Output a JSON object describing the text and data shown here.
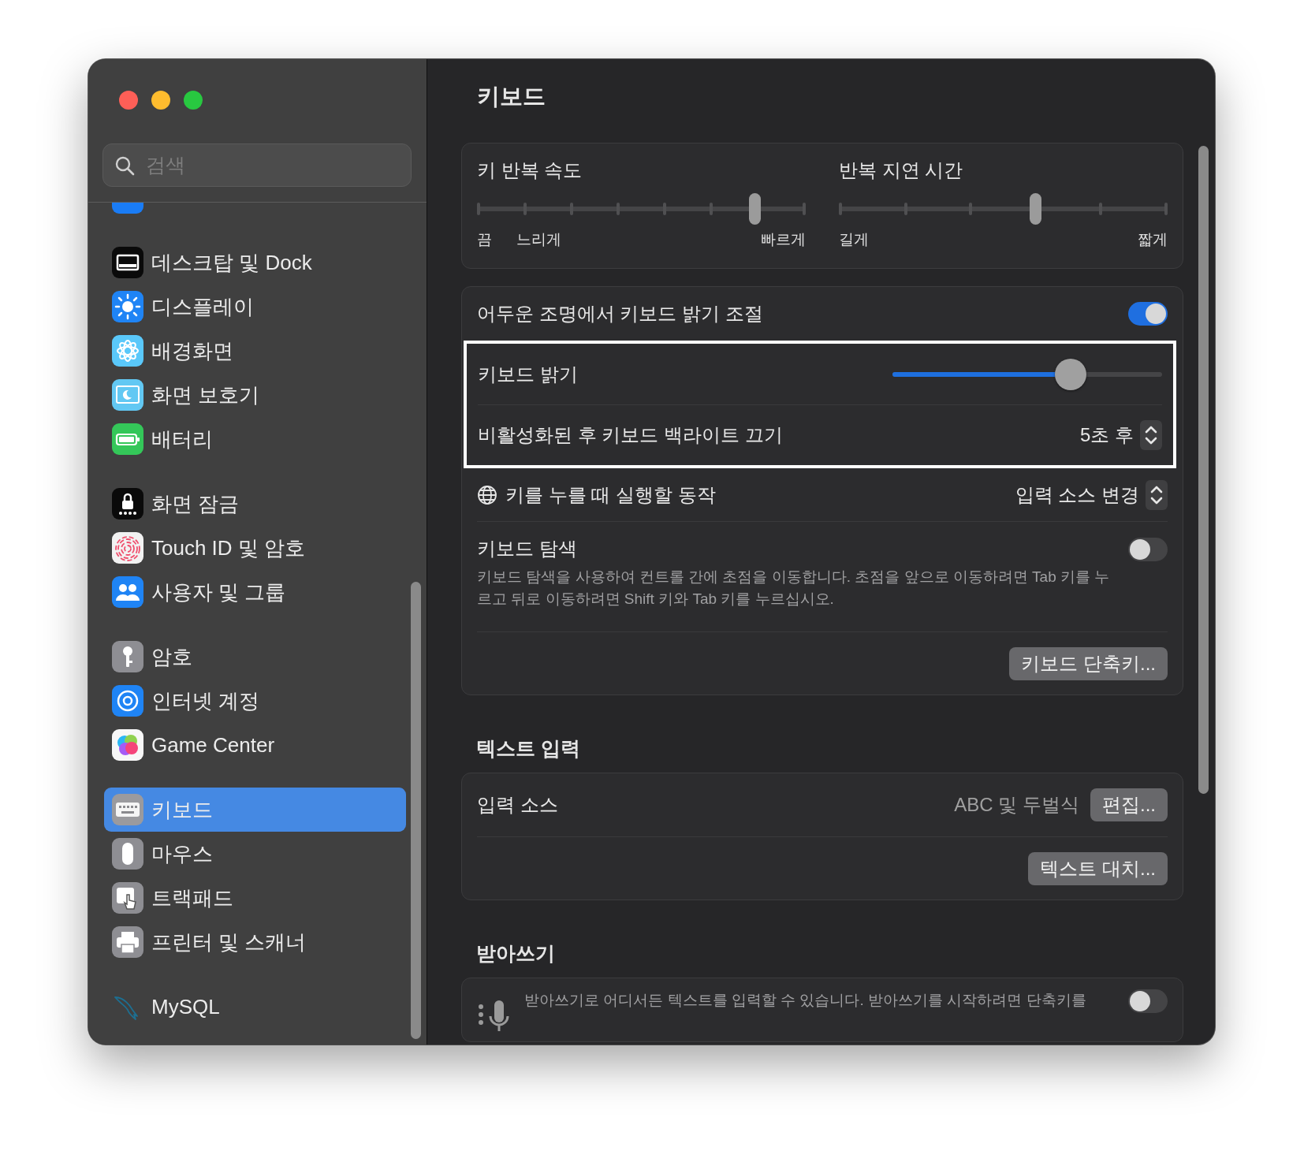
{
  "sidebar": {
    "search": {
      "placeholder": "검색"
    },
    "groups": [
      [
        {
          "kind": "privacy"
        }
      ],
      [
        {
          "label": "데스크탑 및 Dock",
          "kind": "desktop",
          "selected": false
        },
        {
          "label": "디스플레이",
          "kind": "display",
          "selected": false
        },
        {
          "label": "배경화면",
          "kind": "wallpaper",
          "selected": false
        },
        {
          "label": "화면 보호기",
          "kind": "screensaver",
          "selected": false
        },
        {
          "label": "배터리",
          "kind": "battery",
          "selected": false
        }
      ],
      [
        {
          "label": "화면 잠금",
          "kind": "lock",
          "selected": false
        },
        {
          "label": "Touch ID 및 암호",
          "kind": "touchid",
          "selected": false
        },
        {
          "label": "사용자 및 그룹",
          "kind": "users",
          "selected": false
        }
      ],
      [
        {
          "label": "암호",
          "kind": "password",
          "selected": false
        },
        {
          "label": "인터넷 계정",
          "kind": "internet",
          "selected": false
        },
        {
          "label": "Game Center",
          "kind": "gamecenter",
          "selected": false
        }
      ],
      [
        {
          "label": "키보드",
          "kind": "keyboard",
          "selected": true
        },
        {
          "label": "마우스",
          "kind": "mouse",
          "selected": false
        },
        {
          "label": "트랙패드",
          "kind": "trackpad",
          "selected": false
        },
        {
          "label": "프린터 및 스캐너",
          "kind": "printer",
          "selected": false
        }
      ],
      [
        {
          "label": "MySQL",
          "kind": "mysql",
          "selected": false
        }
      ]
    ]
  },
  "content": {
    "title": "키보드",
    "repeat": [
      {
        "label": "키 반복 속도",
        "level": 0.857,
        "labels": [
          "끔",
          "느리게",
          "빠르게"
        ]
      },
      {
        "label": "반복 지연 시간",
        "level": 0.6,
        "labels": [
          "길게",
          "짧게"
        ]
      }
    ],
    "sections": [
      {
        "rows": [
          {
            "kind": "toggle",
            "label": "어두운 조명에서 키보드 밝기 조절",
            "on": true
          },
          {
            "kind": "slider",
            "label": "키보드 밝기",
            "level": 0.66,
            "highlighted": true
          },
          {
            "kind": "popup",
            "label": "비활성화된 후 키보드 백라이트 끄기",
            "value": "5초 후",
            "highlighted": true
          },
          {
            "kind": "popup",
            "label": "키를 누를 때 실행할 동작",
            "value": "입력 소스 변경",
            "globe": true
          },
          {
            "kind": "toggle",
            "label": "키보드 탐색",
            "description": "키보드 탐색을 사용하여 컨트롤 간에 초점을 이동합니다. 초점을 앞으로 이동하려면 Tab 키를 누르고 뒤로 이동하려면 Shift 키와 Tab 키를 누르십시오.",
            "on": false
          },
          {
            "kind": "button",
            "button": "키보드 단축키..."
          }
        ]
      },
      {
        "title": "텍스트 입력",
        "rows": [
          {
            "kind": "value",
            "label": "입력 소스",
            "value": "ABC 및 두벌식",
            "button": "편집..."
          },
          {
            "kind": "button",
            "button": "텍스트 대치..."
          }
        ]
      },
      {
        "title": "받아쓰기",
        "rows": [
          {
            "kind": "mic",
            "description": "받아쓰기로 어디서든 텍스트를 입력할 수 있습니다. 받아쓰기를 시작하려면 단축키를",
            "on": false
          }
        ]
      }
    ]
  }
}
